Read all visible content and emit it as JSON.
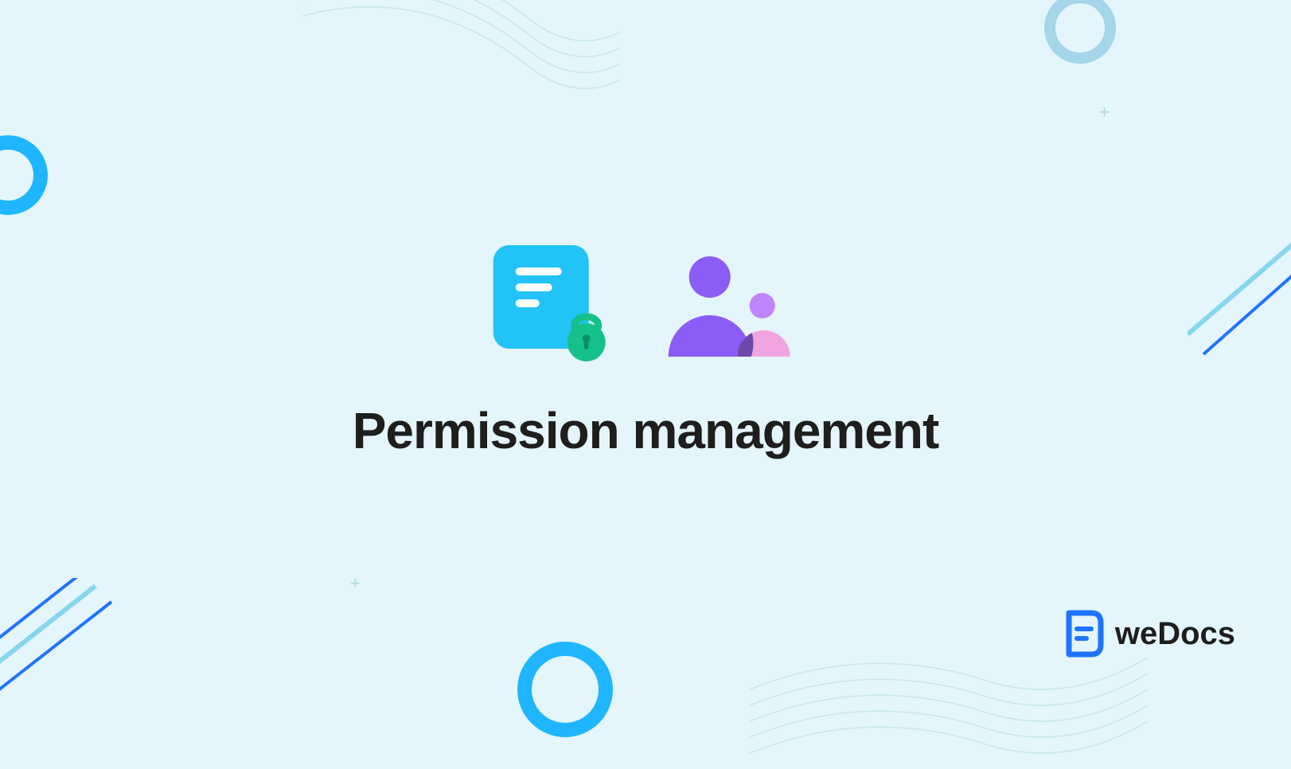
{
  "hero": {
    "title": "Permission management",
    "icons": {
      "document": "document-lock-icon",
      "people": "users-icon"
    }
  },
  "brand": {
    "name": "weDocs"
  },
  "colors": {
    "background": "#e4f5fb",
    "accent_blue": "#22c3f7",
    "accent_green": "#16c08b",
    "accent_purple": "#8b5cf6",
    "accent_pink": "#f7a1dc",
    "logo_blue": "#1f74ff",
    "text": "#1e1e1e"
  }
}
